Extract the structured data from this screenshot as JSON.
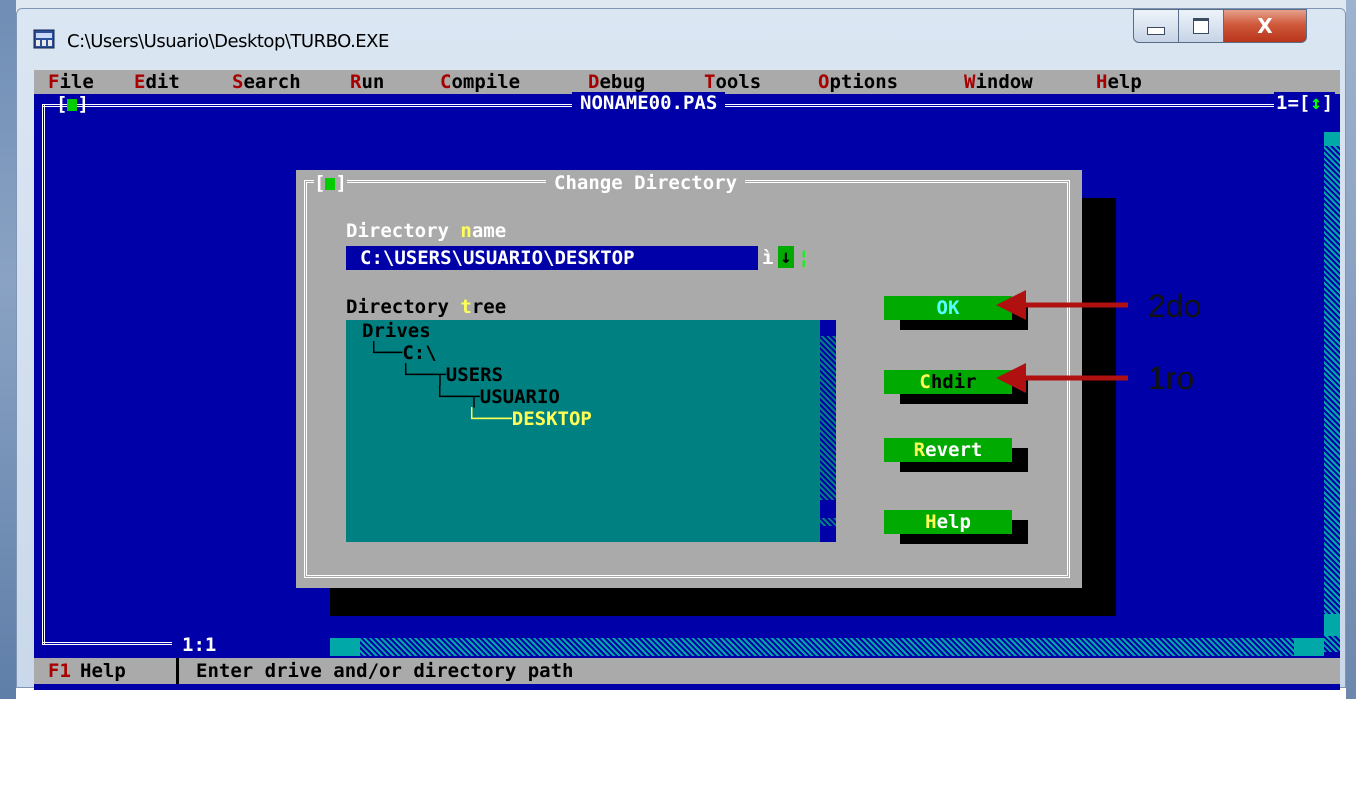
{
  "window": {
    "title": "C:\\Users\\Usuario\\Desktop\\TURBO.EXE",
    "close_label": "X"
  },
  "menubar": [
    {
      "hot": "F",
      "rest": "ile"
    },
    {
      "hot": "E",
      "rest": "dit"
    },
    {
      "hot": "S",
      "rest": "earch"
    },
    {
      "hot": "R",
      "rest": "un"
    },
    {
      "hot": "C",
      "rest": "ompile"
    },
    {
      "hot": "D",
      "rest": "ebug"
    },
    {
      "hot": "T",
      "rest": "ools"
    },
    {
      "hot": "O",
      "rest": "ptions"
    },
    {
      "hot": "W",
      "rest": "indow"
    },
    {
      "hot": "H",
      "rest": "elp"
    }
  ],
  "editor": {
    "close_box": "[■]",
    "file_name": "NONAME00.PAS",
    "window_number": "1=[",
    "window_number_arrow": "↕",
    "window_number_end": "]",
    "cursor_pos": "1:1"
  },
  "dialog": {
    "close_box": "[■]",
    "title": "Change Directory",
    "dir_label_a": "Directory ",
    "dir_label_hot": "n",
    "dir_label_b": "ame",
    "dir_value": "C:\\USERS\\USUARIO\\DESKTOP",
    "history_i": "ì",
    "history_arrow": "↓",
    "history_bar": "¦",
    "tree_label_a": "Directory ",
    "tree_label_hot": "t",
    "tree_label_b": "ree",
    "tree": [
      {
        "text": "Drives",
        "indent": 0,
        "selected": false
      },
      {
        "text": "└──C:\\",
        "indent": 1,
        "selected": false
      },
      {
        "text": "└──┬USERS",
        "indent": 2,
        "selected": false
      },
      {
        "text": "└──┬USUARIO",
        "indent": 3,
        "selected": false
      },
      {
        "text": "└───DESKTOP",
        "indent": 4,
        "selected": true
      }
    ],
    "buttons": [
      {
        "name": "ok",
        "hot": "",
        "rest": "OK"
      },
      {
        "name": "chdir",
        "hot": "C",
        "rest": "hdir"
      },
      {
        "name": "revert",
        "hot": "R",
        "rest": "evert"
      },
      {
        "name": "help",
        "hot": "H",
        "rest": "elp"
      }
    ]
  },
  "status": {
    "key": "F1",
    "key_label": "Help",
    "message": "Enter drive and/or directory path"
  },
  "annotations": {
    "second": "2do",
    "first": "1ro",
    "arrow_color": "#b01010"
  }
}
